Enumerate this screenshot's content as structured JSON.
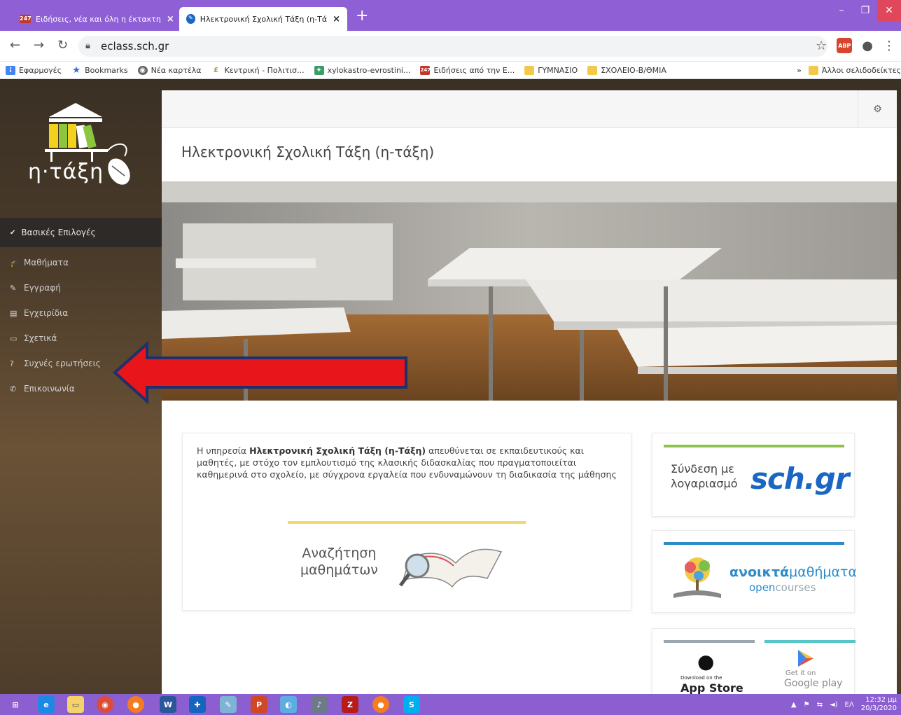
{
  "browser": {
    "tabs": [
      {
        "label": "Ειδήσεις, νέα και όλη η έκτακτη",
        "favicon": "247",
        "active": false
      },
      {
        "label": "Ηλεκτρονική Σχολική Τάξη (η-Τά",
        "favicon": "eclass",
        "active": true
      }
    ],
    "new_tab": "+",
    "url": "eclass.sch.gr",
    "bookmarks": [
      {
        "label": "Εφαρμογές",
        "icon": "apps-icon"
      },
      {
        "label": "Bookmarks",
        "icon": "star-icon"
      },
      {
        "label": "Νέα καρτέλα",
        "icon": "chrome-icon"
      },
      {
        "label": "Κεντρική - Πολιτισ...",
        "icon": "culture-icon"
      },
      {
        "label": "xylokastro-evrostini...",
        "icon": "site-icon"
      },
      {
        "label": "Ειδήσεις από την Ε...",
        "icon": "247-icon"
      },
      {
        "label": "ΓΥΜΝΑΣΙΟ",
        "icon": "folder-icon"
      },
      {
        "label": "ΣΧΟΛΕΙΟ-Β/ΘΜΙΑ",
        "icon": "folder-icon"
      }
    ],
    "more_bookmarks": "»",
    "other_bookmarks": "Άλλοι σελιδοδείκτες"
  },
  "sidebar": {
    "logo_text": "η·τάξη",
    "menu_header": "Βασικές Επιλογές",
    "items": [
      {
        "label": "Μαθήματα",
        "icon": "graduation-cap-icon",
        "glyph": "🎓"
      },
      {
        "label": "Εγγραφή",
        "icon": "edit-icon",
        "glyph": "✎"
      },
      {
        "label": "Εγχειρίδια",
        "icon": "document-icon",
        "glyph": "▤"
      },
      {
        "label": "Σχετικά",
        "icon": "card-icon",
        "glyph": "▭"
      },
      {
        "label": "Συχνές ερωτήσεις",
        "icon": "question-icon",
        "glyph": "?"
      },
      {
        "label": "Επικοινωνία",
        "icon": "phone-icon",
        "glyph": "✆"
      }
    ]
  },
  "main": {
    "site_title": "Ηλεκτρονική Σχολική Τάξη (η-τάξη)",
    "intro_prefix": "Η υπηρεσία ",
    "intro_bold": "Ηλεκτρονική Σχολική Τάξη (η-Τάξη)",
    "intro_suffix": " απευθύνεται σε εκπαιδευτικούς και μαθητές, με στόχο τον εμπλουτισμό της κλασικής διδασκαλίας που πραγματοποιείται καθημερινά στο σχολείο, με σύγχρονα εργαλεία που ενδυναμώνουν τη διαδικασία της μάθησης",
    "search_line1": "Αναζήτηση",
    "search_line2": "μαθημάτων",
    "sch_line1": "Σύνδεση με",
    "sch_line2": "λογαριασμό",
    "sch_logo": "sch.gr",
    "oc_bold": "ανοικτά",
    "oc_rest": "μαθήματα",
    "oc_sub_bold": "open",
    "oc_sub_rest": "courses",
    "appstore_small": "Download on the",
    "appstore_big": "App Store",
    "gplay_small": "Get it on",
    "gplay_big": "Google play"
  },
  "taskbar": {
    "lang": "ΕΛ",
    "time": "12:32 μμ",
    "date": "20/3/2020"
  },
  "colors": {
    "tabbar": "#8f5fd6",
    "taskbar": "#8c5fd0",
    "arrow": "#e8151b",
    "arrow_border": "#1f2f6b",
    "sch_green": "#8fc24a",
    "oc_blue": "#2a8bc9",
    "search_yellow": "#f0d86a"
  }
}
